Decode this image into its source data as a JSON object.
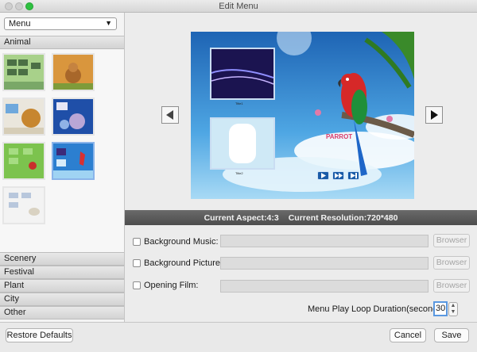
{
  "window": {
    "title": "Edit Menu"
  },
  "sidebar": {
    "dropdown": {
      "selected": "Menu"
    },
    "active_category": "Animal",
    "categories": [
      "Scenery",
      "Festival",
      "Plant",
      "City",
      "Other"
    ],
    "thumbnail_count": 7,
    "selected_thumbnail_index": 5
  },
  "preview": {
    "title_text": "PARROT",
    "chapter_1_caption": "Title1",
    "chapter_2_caption": "Title2",
    "controls": [
      "play-icon",
      "fast-forward-icon",
      "skip-forward-icon"
    ]
  },
  "info": {
    "aspect": "Current Aspect:4:3",
    "resolution": "Current Resolution:720*480"
  },
  "options": {
    "background_music": {
      "label": "Background Music:",
      "checked": false,
      "browse": "Browser"
    },
    "background_picture": {
      "label": "Background Picture:",
      "checked": false,
      "browse": "Browser"
    },
    "opening_film": {
      "label": "Opening Film:",
      "checked": false,
      "browse": "Browser"
    },
    "loop_label": "Menu Play Loop Duration(seconds):",
    "loop_value": "30"
  },
  "footer": {
    "restore": "Restore Defaults",
    "cancel": "Cancel",
    "save": "Save"
  },
  "colors": {
    "accent": "#5a98e0",
    "info_bar": "#555555",
    "sky": "#3b8fd6"
  }
}
